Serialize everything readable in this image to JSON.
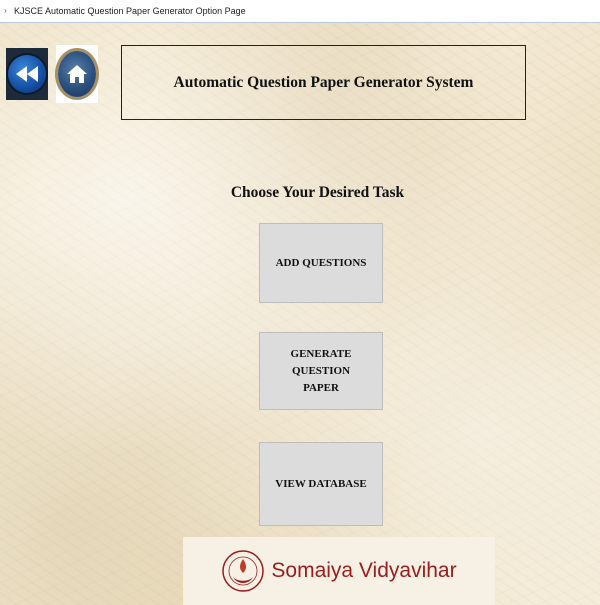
{
  "window": {
    "title": "KJSCE Automatic Question Paper Generator Option Page"
  },
  "nav": {
    "back_icon": "back-arrow-icon",
    "home_icon": "home-icon"
  },
  "header": {
    "title": "Automatic Question Paper Generator System"
  },
  "main": {
    "prompt": "Choose Your Desired Task",
    "buttons": {
      "add_questions": "ADD QUESTIONS",
      "generate_paper": "GENERATE\nQUESTION\nPAPER",
      "view_database": "VIEW DATABASE"
    }
  },
  "footer": {
    "logo_text": "Somaiya Vidyavihar",
    "logo_icon": "somaiya-emblem-icon"
  },
  "colors": {
    "button_bg": "#dcdcdc",
    "logo_text": "#9b1c1c",
    "back_orb": "#1552a8",
    "home_orb": "#2a4f7d"
  }
}
